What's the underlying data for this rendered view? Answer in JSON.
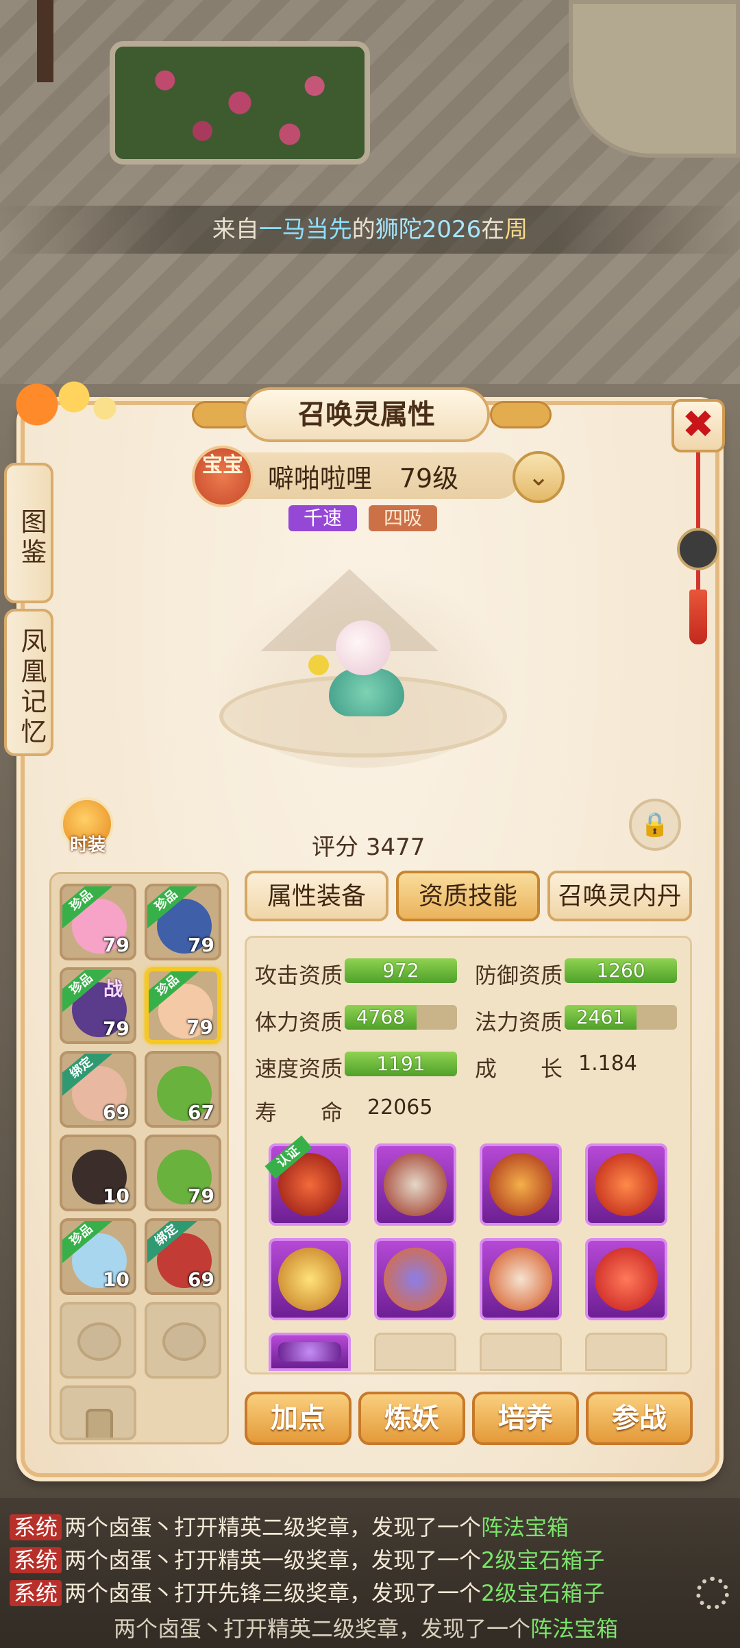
{
  "notice": {
    "p1": "来自",
    "p2": "一马当先",
    "p3": "的",
    "p4": "狮陀2026",
    "p5": "在",
    "p6": "周"
  },
  "panel": {
    "title": "召唤灵属性",
    "close_icon": "✖"
  },
  "side_tabs": [
    "图鉴",
    "凤凰记忆"
  ],
  "pet": {
    "badge": "宝宝",
    "name": "噼啪啦哩",
    "level": "79级",
    "tags": [
      "千速",
      "四吸"
    ],
    "score_label": "评分",
    "score": "3477"
  },
  "fashion_label": "时装",
  "pet_list": [
    {
      "level": "79",
      "ribbon": "珍品",
      "face": "#f6a3c7"
    },
    {
      "level": "79",
      "ribbon": "珍品",
      "face": "#3f5fa8"
    },
    {
      "level": "79",
      "ribbon": "珍品",
      "face": "#5a3b8c",
      "mini": "战"
    },
    {
      "level": "79",
      "ribbon": "珍品",
      "face": "#f4c9a5",
      "selected": true
    },
    {
      "level": "69",
      "ribbon": "绑定",
      "face": "#e8b8a0"
    },
    {
      "level": "67",
      "ribbon": "",
      "face": "#69b23d"
    },
    {
      "level": "10",
      "ribbon": "",
      "face": "#3a2d2a"
    },
    {
      "level": "79",
      "ribbon": "",
      "face": "#69b23d"
    },
    {
      "level": "10",
      "ribbon": "珍品",
      "face": "#a8d6ee"
    },
    {
      "level": "69",
      "ribbon": "绑定",
      "face": "#c23b35"
    }
  ],
  "tabs": [
    "属性装备",
    "资质技能",
    "召唤灵内丹"
  ],
  "stats": {
    "attack_label": "攻击资质",
    "attack": "972",
    "defense_label": "防御资质",
    "defense": "1260",
    "hp_label": "体力资质",
    "hp": "4768",
    "magic_label": "法力资质",
    "magic": "2461",
    "speed_label": "速度资质",
    "speed": "1191",
    "growth_label": "成　　长",
    "growth": "1.184",
    "life_label": "寿　　命",
    "life": "22065"
  },
  "skill_cert": "认证",
  "buttons": [
    "加点",
    "炼妖",
    "培养",
    "参战"
  ],
  "chat": [
    {
      "tag": "系统",
      "a": "两个卤蛋丶打开精英二级奖章，发现了一个",
      "b": "阵法宝箱"
    },
    {
      "tag": "系统",
      "a": "两个卤蛋丶打开精英一级奖章，发现了一个",
      "b": "2级宝石箱子"
    },
    {
      "tag": "系统",
      "a": "两个卤蛋丶打开先锋三级奖章，发现了一个",
      "b": "2级宝石箱子"
    },
    {
      "tag": "",
      "a": "两个卤蛋丶打开精英二级奖章，发现了一个",
      "b": "阵法宝箱"
    }
  ],
  "colors": {
    "accent": "#e49a3a",
    "stat_fill": "#4fa12a",
    "skill_frame": "#b649d6"
  }
}
